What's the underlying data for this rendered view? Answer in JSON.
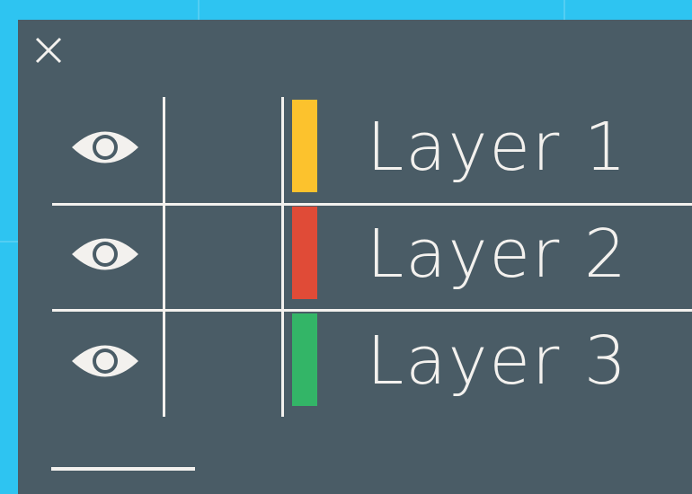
{
  "colors": {
    "background": "#2ec4f1",
    "panel": "#4a5c66",
    "foreground": "#f3f1ee"
  },
  "panel": {
    "close_icon": "close-icon"
  },
  "layers": [
    {
      "label": "Layer 1",
      "color": "#fcc22d",
      "visible": true,
      "eye_icon": "eye-icon"
    },
    {
      "label": "Layer 2",
      "color": "#e04b37",
      "visible": true,
      "eye_icon": "eye-icon"
    },
    {
      "label": "Layer 3",
      "color": "#33b567",
      "visible": true,
      "eye_icon": "eye-icon"
    }
  ]
}
